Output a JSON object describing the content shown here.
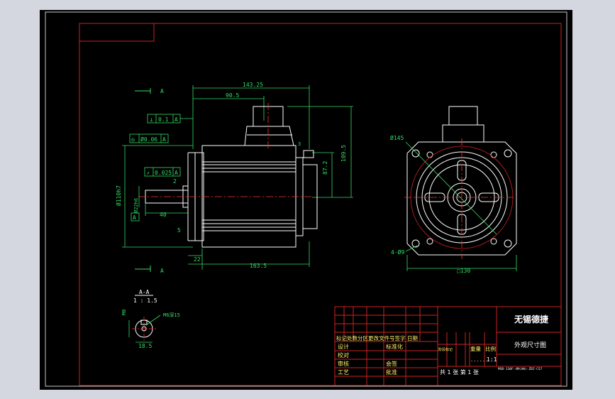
{
  "colors": {
    "background": "#000000",
    "frame": "#cc2222",
    "dimension": "#33dd66",
    "outline": "#ffffff",
    "centerline": "#ff3333",
    "title_text": "#ffffff",
    "table_text": "#ffee66"
  },
  "views": {
    "section_mark_top": "A",
    "section_mark_bottom": "A",
    "dim_total_length": "143.25",
    "dim_top_offset": "90.5",
    "dim_height_total": "109.5",
    "dim_height_partial": "87.2",
    "dim_body_length": "163.5",
    "dim_flange": "22",
    "dim_shaft_len": "40",
    "dim_shaft_dia": "Ø22h6",
    "dim_pilot_dia": "Ø110h7",
    "dim_small_2": "2",
    "dim_small_5": "5",
    "dim_small_3": "3",
    "tol_perp_symbol": "⊥",
    "tol_perp_value": "0.1",
    "tol_perp_datum": "A",
    "tol_conc_symbol": "◎",
    "tol_conc_value": "Ø0.06",
    "tol_conc_datum": "A",
    "tol_runout_symbol": "↗",
    "tol_runout_value": "0.025",
    "tol_runout_datum": "A",
    "datum_label": "A",
    "front_pcd": "Ø145",
    "front_holes": "4-Ø9",
    "front_square": "□130",
    "section_title": "A-A",
    "section_scale": "1 : 1.5",
    "section_width": "M8",
    "section_thread": "M6深15",
    "section_key": "18.5"
  },
  "title_block": {
    "company": "无锡德捷",
    "drawing_name": "外观尺寸图",
    "weight_label": "重量",
    "scale_label": "比例",
    "scale_value": "1:1",
    "revision_header": "标记处数分区更改文件号签字 日期",
    "stage_labels": "阶段标记",
    "design": "设计",
    "standardize": "标准化",
    "proofread": "校对",
    "review": "审核",
    "countersign": "会签",
    "process": "工艺",
    "approve": "批准",
    "sheet_info": "共 1 张 第 1 张",
    "model_code": "MSB-130F-4M(AW)-ZDZ-CS7",
    "dots": "......"
  }
}
